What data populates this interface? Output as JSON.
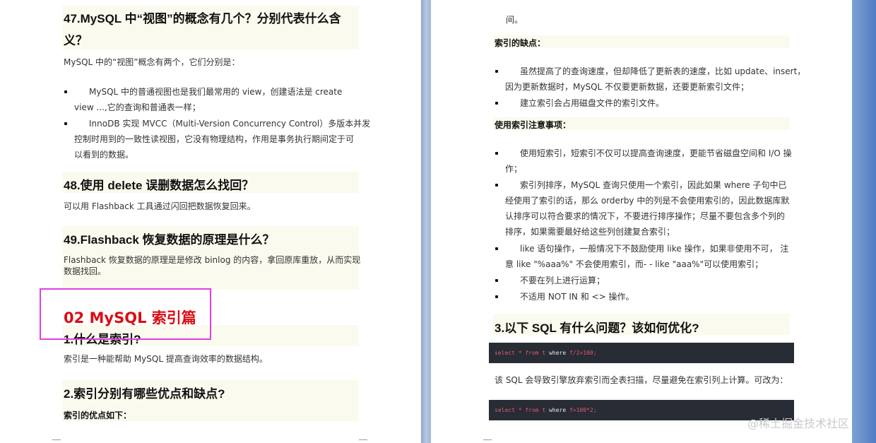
{
  "left_page": {
    "q47_title_line1": "47.MySQL 中“视图”的概念有几个？分别代表什么含",
    "q47_title_line2": "义？",
    "q47_intro": "MySQL 中的“视图”概念有两个，它们分别是：",
    "q47_items": [
      [
        "MySQL 中的普通视图也是我们最常用的 view，创建语法是 create",
        "view ...,它的查询和普通表一样；"
      ],
      [
        "InnoDB 实现 MVCC（Multi-Version Concurrency Control）多版本并发",
        "控制时用到的一致性读视图，它没有物理结构，作用是事务执行期间定于可",
        "以看到的数据。"
      ]
    ],
    "q48_title": "48.使用 delete 误删数据怎么找回？",
    "q48_answer": "可以用 Flashback 工具通过闪回把数据恢复回来。",
    "q49_title": "49.Flashback 恢复数据的原理是什么？",
    "q49_answer_line1": "Flashback 恢复数据的原理是是修改 binlog 的内容，拿回原库重放，从而实现",
    "q49_answer_line2": "数据找回。",
    "section_title": "02 MySQL 索引篇",
    "s1_title": "1.什么是索引?",
    "s1_answer": "索引是一种能帮助 MySQL 提高查询效率的数据结构。",
    "s2_title": "2.索引分别有哪些优点和缺点?",
    "s2_pros_label": "索引的优点如下："
  },
  "right_page": {
    "top_fragment": "间。",
    "cons_label": "索引的缺点：",
    "cons_items": [
      [
        "虽然提高了的查询速度，但却降低了更新表的速度，比如 update、insert，",
        "因为更新数据时，MySQL 不仅要更新数据，还要更新索引文件；"
      ],
      [
        "建立索引会占用磁盘文件的索引文件。"
      ]
    ],
    "notes_label": "使用索引注意事项：",
    "notes_items": [
      [
        "使用短索引，短索引不仅可以提高查询速度，更能节省磁盘空间和 I/O 操",
        "作；"
      ],
      [
        "索引列排序，MySQL 查询只使用一个索引，因此如果 where 子句中已",
        "经使用了索引的话，那么 orderby 中的列是不会使用索引的，因此数据库默",
        "认排序可以符合要求的情况下，不要进行排序操作；尽量不要包含多个列的",
        "排序，如果需要最好给这些列创建复合索引；"
      ],
      [
        "like 语句操作，一般情况下不鼓励使用 like 操作，如果非使用不可， 注",
        "意 like \"%aaa%\" 不会使用索引，而- - like \"aaa%\"可以使用索引；"
      ],
      [
        "不要在列上进行运算；"
      ],
      [
        "不适用 NOT IN 和 <> 操作。"
      ]
    ],
    "q3_title": "3.以下 SQL 有什么问题？该如何优化?",
    "code1": {
      "a": "select * from t ",
      "b": "where",
      "c": " f/2=100;"
    },
    "q3_answer": "该 SQL 会导致引擎放弃索引而全表扫描，尽量避免在索引列上计算。可改为：",
    "code2": {
      "a": "select * from t ",
      "b": "where",
      "c": " f=100*2;"
    }
  },
  "watermark": "@稀土掘金技术社区",
  "colors": {
    "section_red": "#d90e15",
    "highlight_box": "#e13ee0",
    "code_bg": "#282c34",
    "heading_shade": "#fbfaee"
  }
}
